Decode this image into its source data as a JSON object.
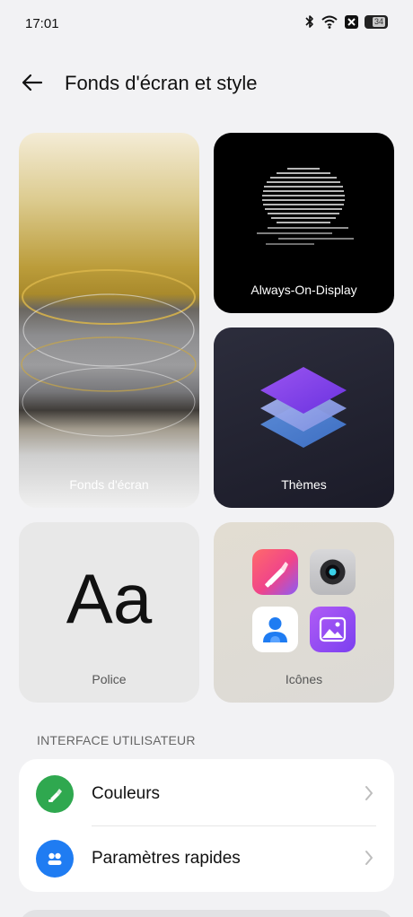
{
  "status_bar": {
    "time": "17:01",
    "battery": "34",
    "icons": [
      "bluetooth-icon",
      "wifi-icon",
      "notification-icon",
      "battery-icon"
    ]
  },
  "header": {
    "back_icon": "arrow-left-icon",
    "title": "Fonds d'écran et style"
  },
  "tiles": {
    "wallpaper": {
      "label": "Fonds d'écran"
    },
    "aod": {
      "label": "Always-On-Display"
    },
    "themes": {
      "label": "Thèmes"
    },
    "font": {
      "label": "Police",
      "sample": "Aa"
    },
    "icons": {
      "label": "Icônes",
      "app_icons": [
        "paint-brush-icon",
        "camera-icon",
        "contact-icon",
        "gallery-icon"
      ]
    }
  },
  "section": {
    "title": "INTERFACE UTILISATEUR"
  },
  "settings": [
    {
      "label": "Couleurs",
      "icon": "palette-icon",
      "color": "#2fa84f"
    },
    {
      "label": "Paramètres rapides",
      "icon": "quick-settings-icon",
      "color": "#1f7cf2"
    }
  ],
  "colors": {
    "background": "#f2f2f4",
    "card": "#ffffff"
  }
}
